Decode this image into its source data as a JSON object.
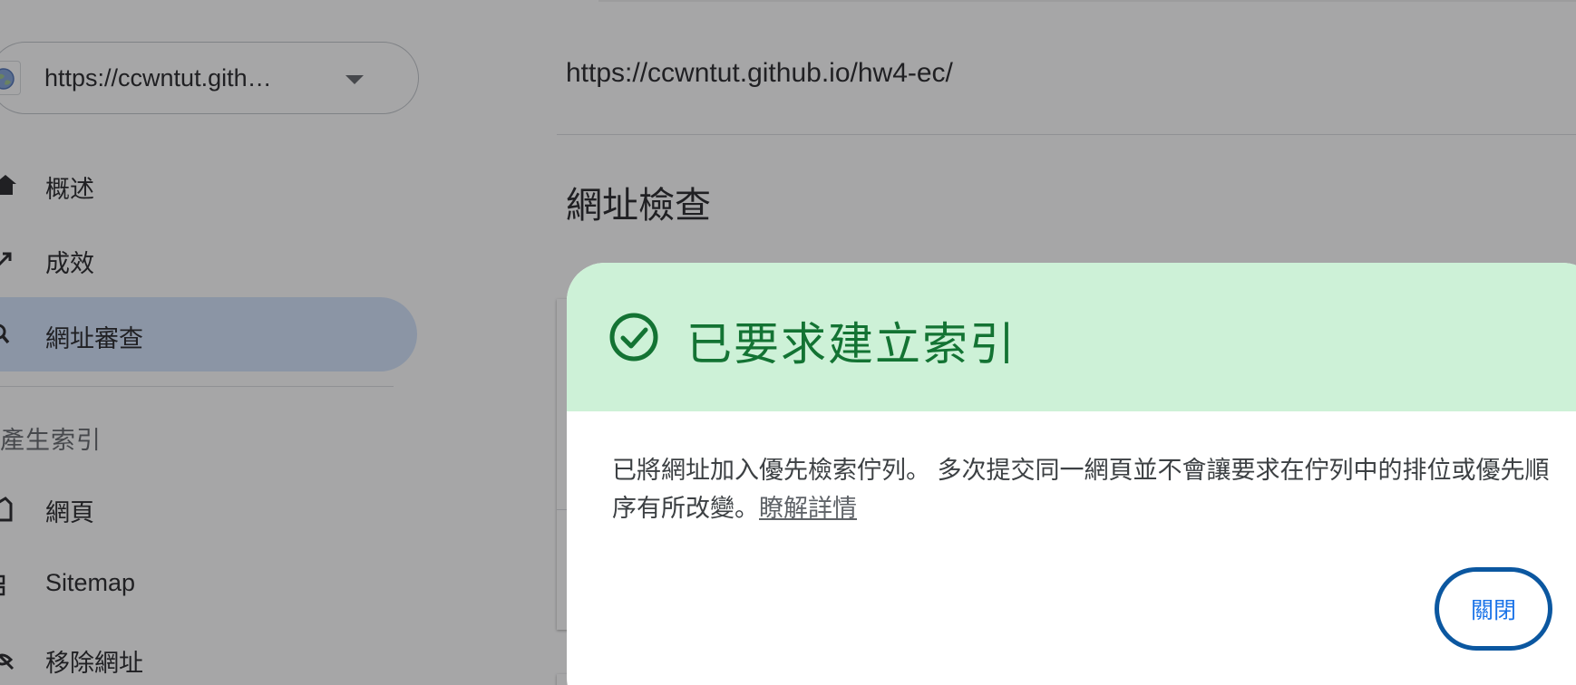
{
  "property": {
    "url": "https://ccwntut.gith…"
  },
  "sidebar": {
    "items": [
      {
        "label": "概述",
        "icon": "home-icon"
      },
      {
        "label": "成效",
        "icon": "trending-up-icon"
      },
      {
        "label": "網址審查",
        "icon": "search-icon",
        "active": true
      },
      {
        "label": "網頁",
        "icon": "page-icon"
      },
      {
        "label": "Sitemap",
        "icon": "sitemap-icon"
      },
      {
        "label": "移除網址",
        "icon": "visibility-off-icon"
      }
    ],
    "section_header": "產生索引"
  },
  "main": {
    "inspected_url": "https://ccwntut.github.io/hw4-ec/",
    "page_title": "網址檢查"
  },
  "dialog": {
    "title": "已要求建立索引",
    "body": "已將網址加入優先檢索佇列。 多次提交同一網頁並不會讓要求在佇列中的排位或優先順序有所改變。",
    "learn_more": "瞭解詳情",
    "close_label": "關閉"
  },
  "colors": {
    "header_bg": "#cdf1d7",
    "title_green": "#137333",
    "close_border": "#0b57a0",
    "close_text": "#1a73e8",
    "active_nav_bg": "#d2e3fc"
  }
}
